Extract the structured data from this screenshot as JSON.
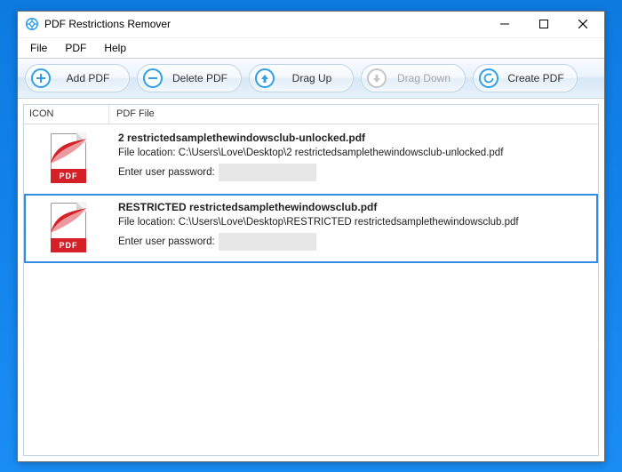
{
  "window": {
    "title": "PDF Restrictions Remover"
  },
  "menu": {
    "file": "File",
    "pdf": "PDF",
    "help": "Help"
  },
  "toolbar": {
    "add_pdf": "Add PDF",
    "delete_pdf": "Delete PDF",
    "drag_up": "Drag Up",
    "drag_down": "Drag Down",
    "create_pdf": "Create PDF"
  },
  "columns": {
    "icon": "ICON",
    "file": "PDF File"
  },
  "labels": {
    "file_location_prefix": "File location: ",
    "password_prompt": "Enter user password:",
    "pdf_badge": "PDF"
  },
  "rows": [
    {
      "name": "2 restrictedsamplethewindowsclub-unlocked.pdf",
      "location": "C:\\Users\\Love\\Desktop\\2 restrictedsamplethewindowsclub-unlocked.pdf",
      "selected": false
    },
    {
      "name": "RESTRICTED restrictedsamplethewindowsclub.pdf",
      "location": "C:\\Users\\Love\\Desktop\\RESTRICTED restrictedsamplethewindowsclub.pdf",
      "selected": true
    }
  ]
}
